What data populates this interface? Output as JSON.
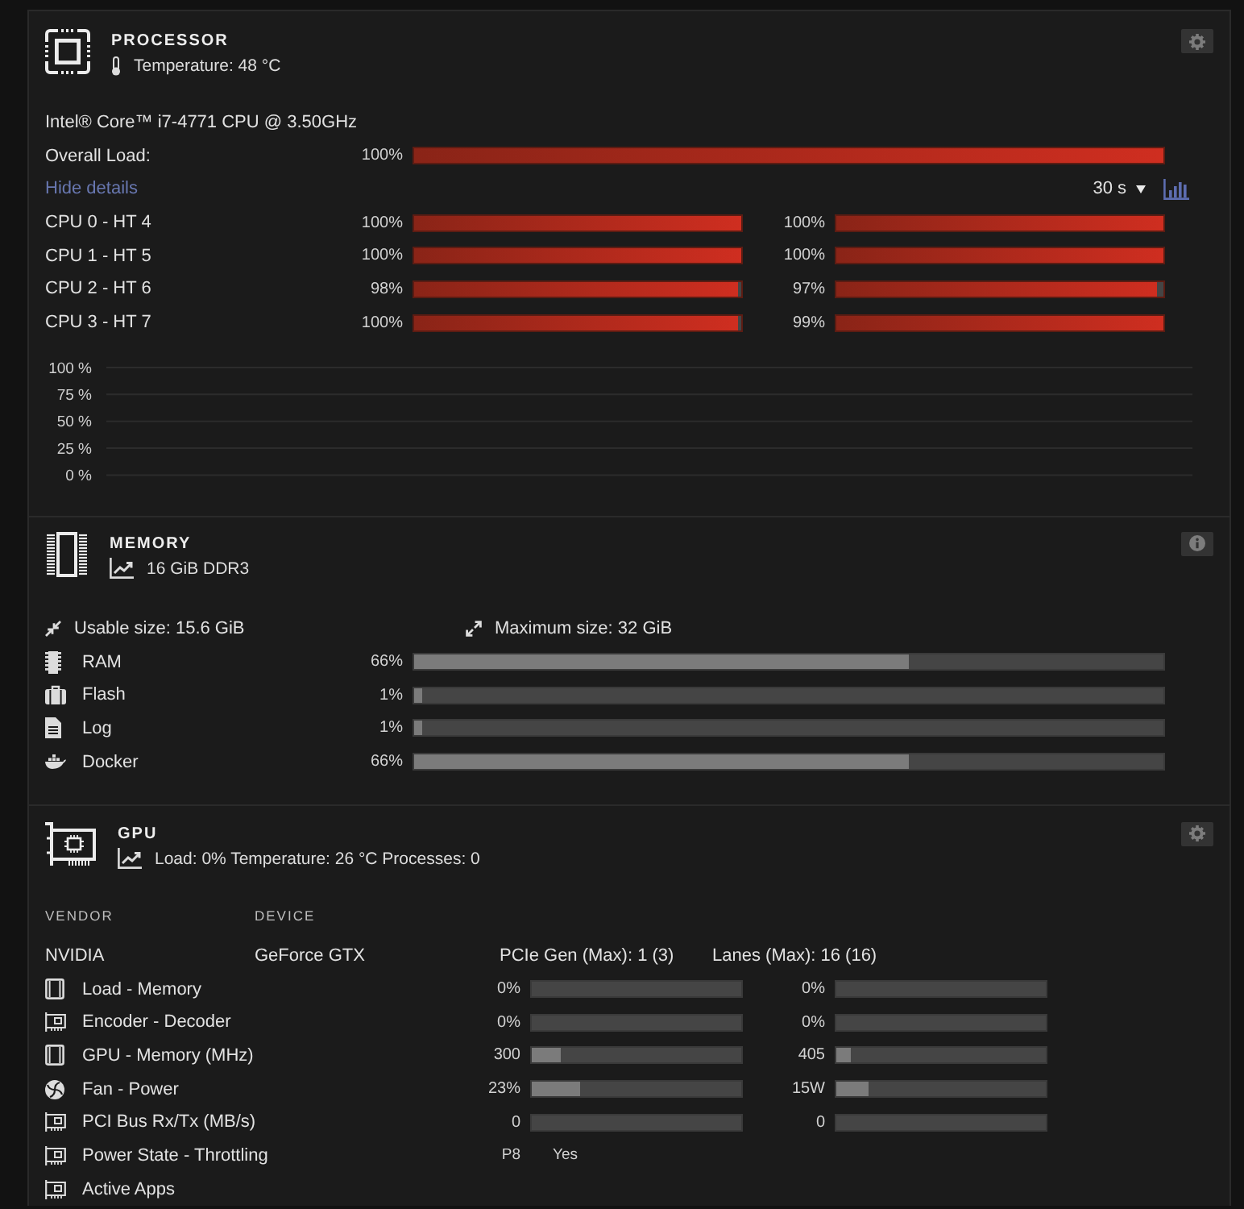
{
  "processor": {
    "title": "PROCESSOR",
    "temperature": "Temperature: 48 °C",
    "button": {
      "kind": "settings"
    },
    "model": "Intel® Core™ i7-4771 CPU @ 3.50GHz",
    "overall": {
      "label": "Overall Load:",
      "reading": "100%",
      "level": 1
    },
    "details_link": "Hide details",
    "interval": "30 s",
    "cores": [
      {
        "label": "CPU 0 - HT 4",
        "threads": [
          {
            "reading": "100%",
            "level": 1
          },
          {
            "reading": "100%",
            "level": 1
          }
        ]
      },
      {
        "label": "CPU 1 - HT 5",
        "threads": [
          {
            "reading": "100%",
            "level": 1
          },
          {
            "reading": "100%",
            "level": 1
          }
        ]
      },
      {
        "label": "CPU 2 - HT 6",
        "threads": [
          {
            "reading": "98%",
            "level": 0.99
          },
          {
            "reading": "97%",
            "level": 0.98
          }
        ]
      },
      {
        "label": "CPU 3 - HT 7",
        "threads": [
          {
            "reading": "100%",
            "level": 0.99
          },
          {
            "reading": "99%",
            "level": 1
          }
        ]
      }
    ],
    "load_graph": {
      "scale": [
        "100 %",
        "75 %",
        "50 %",
        "25 %",
        "0 %"
      ]
    }
  },
  "memory": {
    "title": "MEMORY",
    "summary": "16 GiB DDR3",
    "button": {
      "kind": "info"
    },
    "usable": "Usable size: 15.6 GiB",
    "maximum": "Maximum size: 32 GiB",
    "items": [
      {
        "kind": "ram",
        "label": "RAM",
        "reading": "66%",
        "level": 0.66
      },
      {
        "kind": "flash",
        "label": "Flash",
        "reading": "1%",
        "level": 0.01
      },
      {
        "kind": "log",
        "label": "Log",
        "reading": "1%",
        "level": 0.01
      },
      {
        "kind": "docker",
        "label": "Docker",
        "reading": "66%",
        "level": 0.66
      }
    ]
  },
  "gpu": {
    "title": "GPU",
    "summary": "Load: 0% Temperature: 26 °C Processes: 0",
    "button": {
      "kind": "settings"
    },
    "columns": [
      "VENDOR",
      "DEVICE"
    ],
    "vendor": "NVIDIA",
    "device": "GeForce GTX",
    "pcie": "PCIe Gen (Max): 1 (3)",
    "lanes": "Lanes (Max): 16 (16)",
    "metrics": [
      {
        "kind": "bars",
        "label": "Load - Memory",
        "values": [
          {
            "reading": "0%",
            "level": 0
          },
          {
            "reading": "0%",
            "level": 0
          }
        ]
      },
      {
        "kind": "bars",
        "label": "Encoder - Decoder",
        "values": [
          {
            "reading": "0%",
            "level": 0
          },
          {
            "reading": "0%",
            "level": 0
          }
        ]
      },
      {
        "kind": "bars",
        "label": "GPU - Memory (MHz)",
        "values": [
          {
            "reading": "300",
            "level": 0.14
          },
          {
            "reading": "405",
            "level": 0.07
          }
        ]
      },
      {
        "kind": "bars",
        "label": "Fan - Power",
        "values": [
          {
            "reading": "23%",
            "level": 0.23
          },
          {
            "reading": "15W",
            "level": 0.15
          }
        ]
      },
      {
        "kind": "bars",
        "label": "PCI Bus Rx/Tx (MB/s)",
        "values": [
          {
            "reading": "0",
            "level": 0
          },
          {
            "reading": "0",
            "level": 0
          }
        ]
      },
      {
        "kind": "text",
        "label": "Power State - Throttling",
        "texts": [
          "P8",
          "Yes"
        ]
      },
      {
        "kind": "plain",
        "label": "Active Apps"
      }
    ]
  }
}
